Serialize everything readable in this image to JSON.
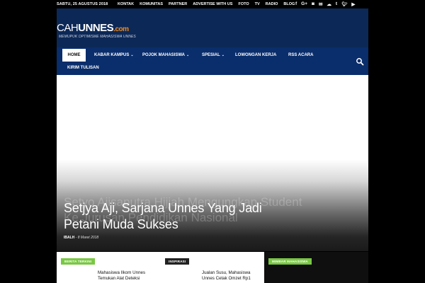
{
  "topbar": {
    "date": "SABTU, 25 AGUSTUS 2018",
    "menu": [
      "KONTAK",
      "KOMUNITAS",
      "PARTNER",
      "ADVERTISE WITH US",
      "FOTO",
      "TV",
      "RADIO",
      "BLOG"
    ],
    "social_icons": [
      "facebook-icon",
      "google-plus-icon",
      "instagram-icon",
      "email-icon",
      "soundcloud-icon",
      "tumblr-icon",
      "twitter-icon",
      "youtube-icon"
    ]
  },
  "header": {
    "logo_prefix": "CAH",
    "logo_main": "UNNES",
    "logo_suffix": ".com",
    "tagline": "MEMUPUK OPTIMISME MAHASISWA UNNES",
    "bg_color": "#0c2856",
    "accent_color": "#f08a1d"
  },
  "nav": {
    "home": "HOME",
    "items": [
      "KABAR KAMPUS",
      "POJOK MAHASISWA",
      "SPESIAL",
      "LOWONGAN KERJA",
      "RSS ACARA",
      "KIRIM TULISAN"
    ],
    "caret": "⌄",
    "search_icon": "search-icon",
    "bg_color": "#0a2d6b"
  },
  "hero": {
    "headline_line1": "Setjya Aji, Sarjana Unnes Yang Jadi",
    "headline_line2": "Petani Muda Sukses",
    "ghost_line1": "Setyo Ajisaputra Hijjah Mengungkap Student",
    "ghost_line2": "Ke Jurusan Pendidikan Nasional",
    "author": "IBALH",
    "date": "8 Maret 2018"
  },
  "strip": {
    "col1": {
      "badge": "BERITA TERKINI",
      "title": "Mahasiswa Ilkom Unnes Temukan Alat Deteksi"
    },
    "col2": {
      "badge": "INSPIRASI",
      "title": "Jualan Susu, Mahasiswa Unnes Cetak Omzet Rp1"
    },
    "col3": {
      "badge": "MIMBAR MAHASISWA"
    }
  }
}
